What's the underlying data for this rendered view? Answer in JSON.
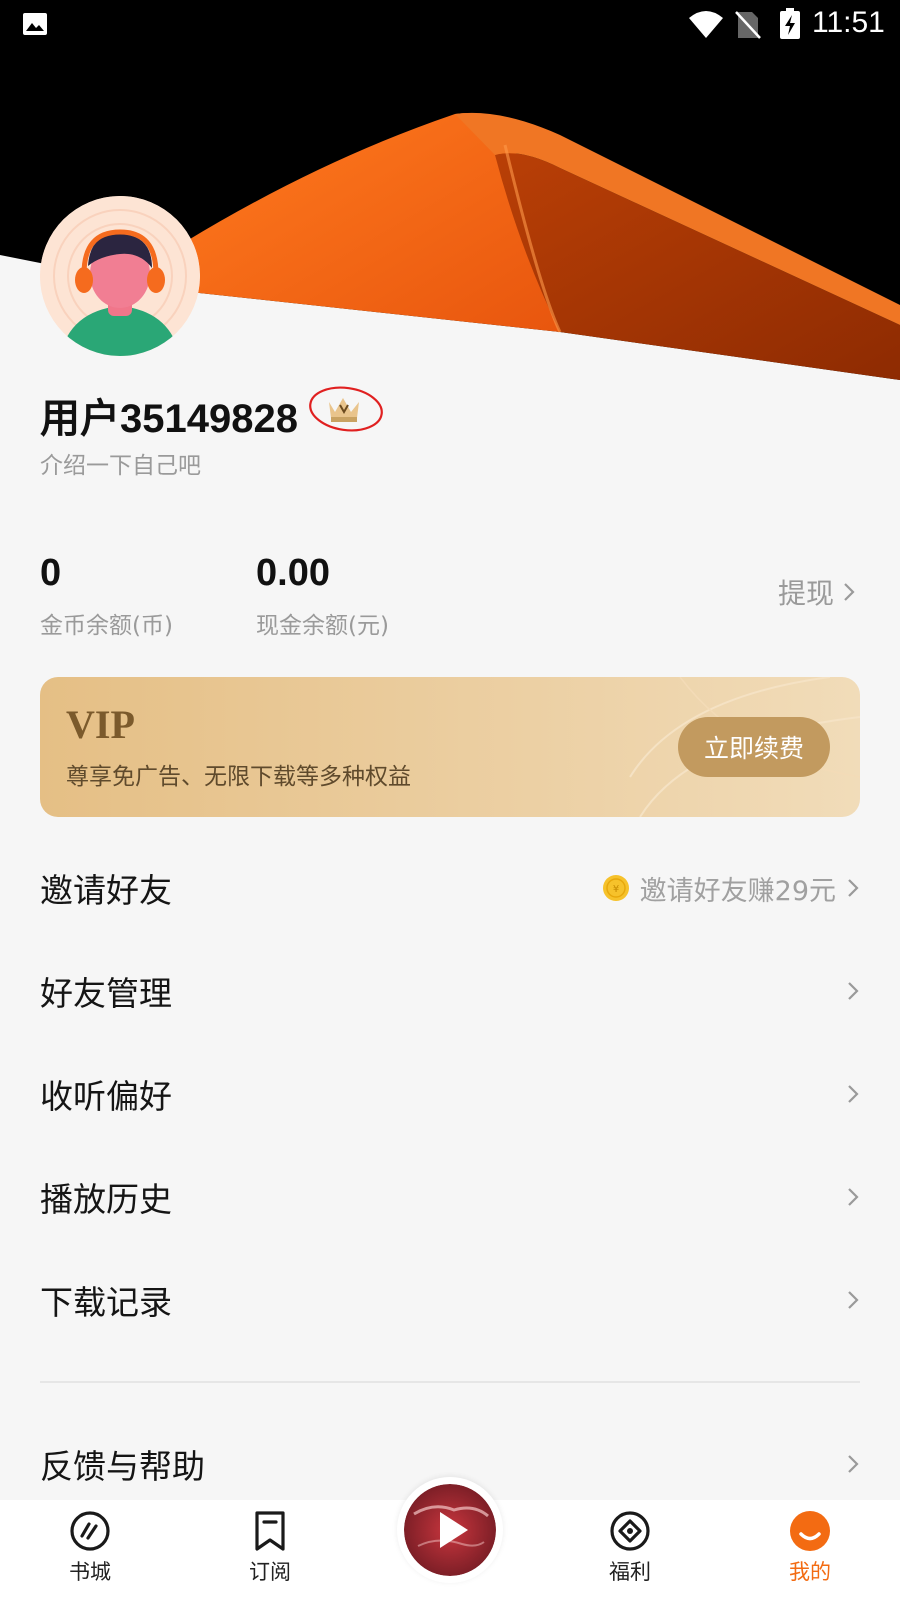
{
  "status_bar": {
    "time": "11:51",
    "icons": [
      "gallery-icon",
      "wifi-icon",
      "no-sim-icon",
      "battery-charging-icon"
    ]
  },
  "profile": {
    "username": "用户35149828",
    "bio": "介绍一下自己吧",
    "badge_icon": "vip-crown-icon"
  },
  "balances": {
    "coins": {
      "value": "0",
      "label": "金币余额(币)"
    },
    "cash": {
      "value": "0.00",
      "label": "现金余额(元)"
    },
    "withdraw_label": "提现"
  },
  "vip_card": {
    "title": "VIP",
    "description": "尊享免广告、无限下载等多种权益",
    "button_label": "立即续费"
  },
  "menu": [
    {
      "label": "邀请好友",
      "hint": "邀请好友赚29元"
    },
    {
      "label": "好友管理"
    },
    {
      "label": "收听偏好"
    },
    {
      "label": "播放历史"
    },
    {
      "label": "下载记录"
    },
    {
      "label": "反馈与帮助"
    }
  ],
  "bottom_nav": {
    "items": [
      {
        "label": "书城",
        "icon": "bookstore-icon"
      },
      {
        "label": "订阅",
        "icon": "bookmark-icon"
      },
      {
        "label": "福利",
        "icon": "welfare-icon"
      },
      {
        "label": "我的",
        "icon": "profile-icon",
        "active": true
      }
    ],
    "play_icon": "play-icon"
  },
  "colors": {
    "accent": "#f36b12",
    "vip_gold": "#c29a5f",
    "background": "#f6f6f6"
  }
}
